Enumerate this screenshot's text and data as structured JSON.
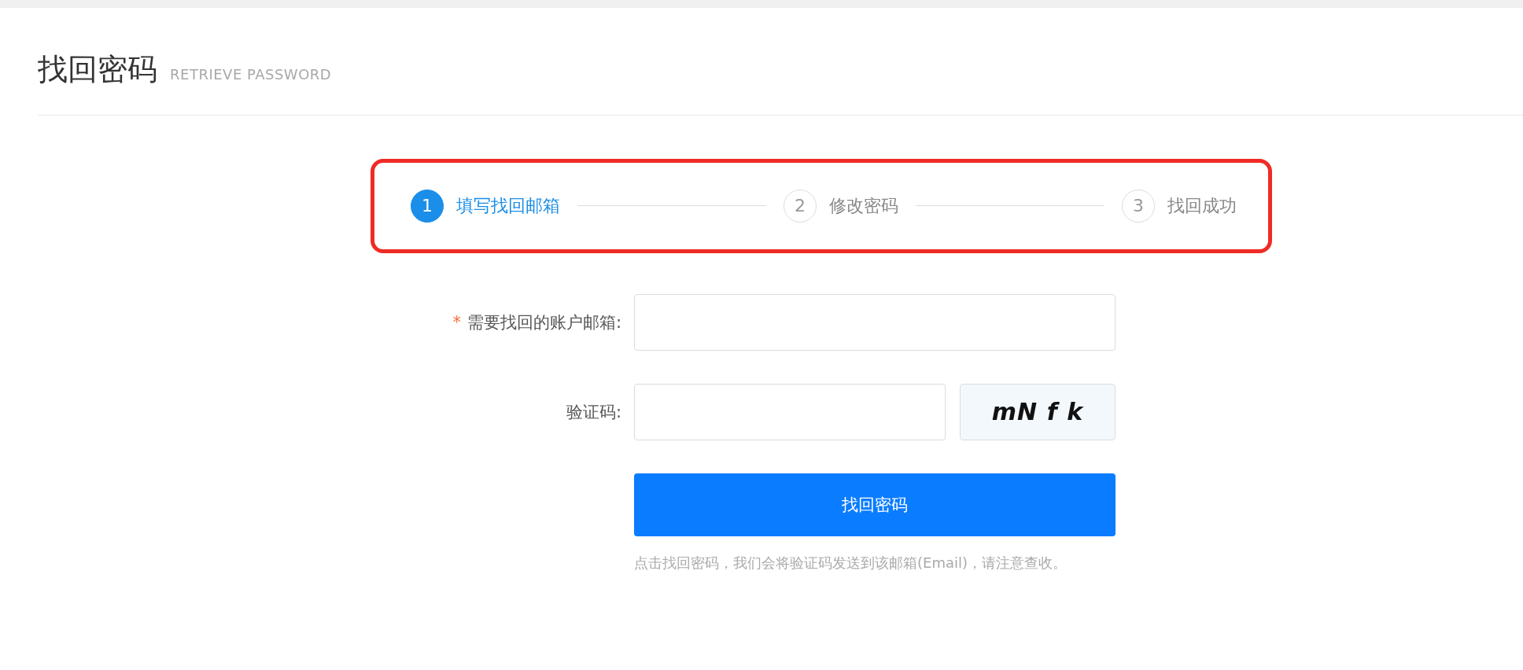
{
  "header": {
    "title": "找回密码",
    "subtitle": "RETRIEVE PASSWORD"
  },
  "steps": [
    {
      "number": "1",
      "label": "填写找回邮箱",
      "selected": true
    },
    {
      "number": "2",
      "label": "修改密码",
      "selected": false
    },
    {
      "number": "3",
      "label": "找回成功",
      "selected": false
    }
  ],
  "form": {
    "fields": [
      {
        "kind": "text",
        "label": "需要找回的账户邮箱:",
        "marker": "*"
      },
      {
        "kind": "captcha",
        "label": "验证码:",
        "captcha": "mN f k"
      }
    ],
    "submit": "找回密码",
    "hint": "点击找回密码，我们会将验证码发送到该邮箱(Email)，请注意查收。"
  }
}
